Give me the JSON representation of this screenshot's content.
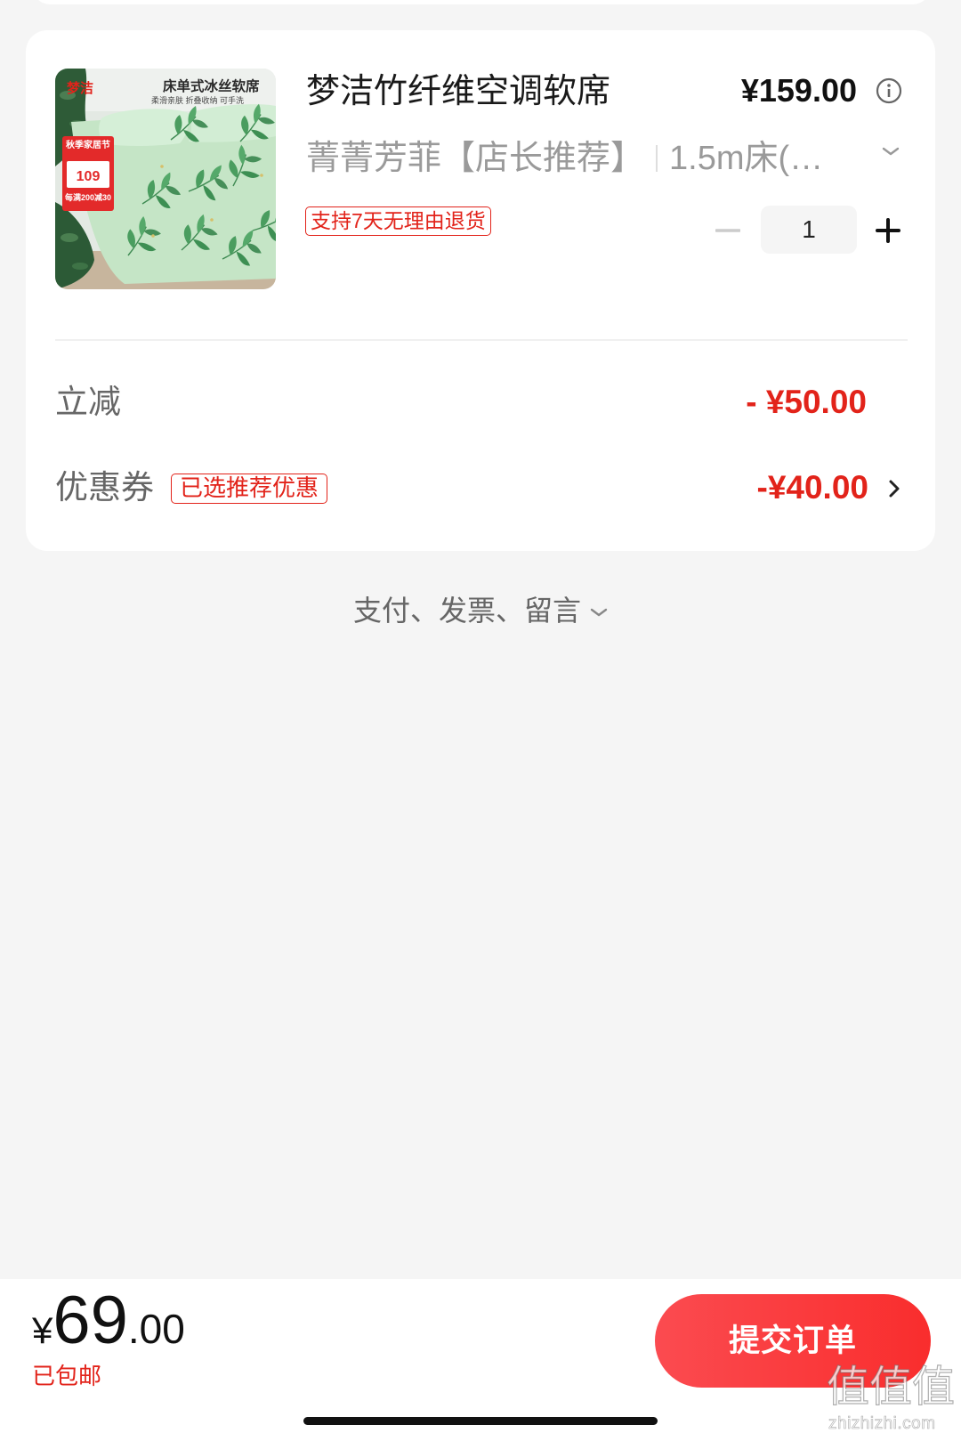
{
  "order": {
    "product": {
      "title": "梦洁竹纤维空调软席",
      "price": "¥159.00",
      "spec_name": "菁菁芳菲【店长推荐】",
      "spec_size": "1.5m床(…",
      "return_policy_tag": "支持7天无理由退货",
      "quantity": "1",
      "image": {
        "brand_logo": "梦洁",
        "headline": "床单式冰丝软席",
        "subline": "柔滑亲肤 折叠收纳 可手洗",
        "badge_title": "秋季家居节",
        "badge_price": "109",
        "badge_offer": "每满200减30"
      }
    },
    "instant_discount": {
      "label": "立减",
      "value": "- ¥50.00"
    },
    "coupon": {
      "label": "优惠券",
      "tag": "已选推荐优惠",
      "value": "-¥40.00"
    }
  },
  "more_options": {
    "label": "支付、发票、留言"
  },
  "footer": {
    "currency_symbol": "¥",
    "total_integer": "69",
    "total_decimal": ".00",
    "shipping_note": "已包邮",
    "submit_label": "提交订单"
  },
  "watermark": {
    "logo_text": "值值值",
    "site": "zhizhizhi.com"
  },
  "icons": {
    "price_info": "info-icon",
    "spec_expand": "chevron-down-icon",
    "decrease": "minus-icon",
    "increase": "plus-icon",
    "coupon_open": "chevron-right-icon",
    "more_expand": "chevron-down-icon"
  },
  "colors": {
    "accent_red": "#e2231a",
    "page_background": "#f5f5f5",
    "card_background": "#ffffff",
    "muted_text": "#999999",
    "submit_gradient_start": "#fb4b50",
    "submit_gradient_end": "#f92d2d"
  }
}
